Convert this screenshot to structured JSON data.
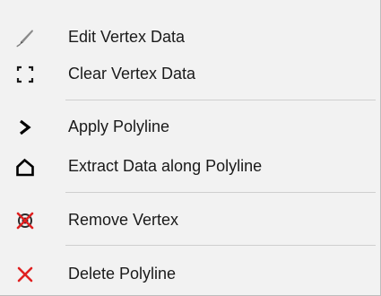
{
  "context_menu": {
    "items": [
      {
        "label": "Edit Vertex Data",
        "icon": "pencil-icon"
      },
      {
        "label": "Clear Vertex Data",
        "icon": "clear-brackets-icon"
      },
      {
        "label": "Apply Polyline",
        "icon": "chevron-right-icon"
      },
      {
        "label": "Extract Data along Polyline",
        "icon": "polyline-outline-icon"
      },
      {
        "label": "Remove Vertex",
        "icon": "remove-vertex-icon"
      },
      {
        "label": "Delete Polyline",
        "icon": "delete-x-icon"
      }
    ]
  },
  "colors": {
    "menu_background": "#f2f2f2",
    "separator": "#cfcfcf",
    "danger_red": "#e02020",
    "icon_gray": "#7a7a7a"
  }
}
